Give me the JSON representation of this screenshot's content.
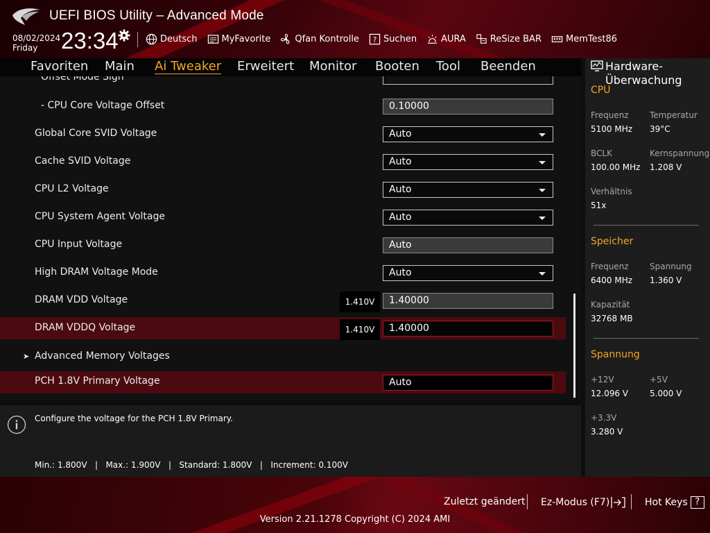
{
  "header": {
    "title": "UEFI BIOS Utility – Advanced Mode",
    "date": "08/02/2024",
    "weekday": "Friday",
    "time": "23:34",
    "toolbar": {
      "language": "Deutsch",
      "myfavorite": "MyFavorite",
      "qfan": "Qfan Kontrolle",
      "search": "Suchen",
      "aura": "AURA",
      "resizebar": "ReSize BAR",
      "memtest": "MemTest86"
    }
  },
  "nav": {
    "tabs": [
      "Favoriten",
      "Main",
      "Ai Tweaker",
      "Erweitert",
      "Monitor",
      "Booten",
      "Tool",
      "Beenden"
    ],
    "active": "Ai Tweaker"
  },
  "settings": {
    "rows": [
      {
        "label": "Offset Mode Sign",
        "value": ""
      },
      {
        "label": "- CPU Core Voltage Offset",
        "value": "0.10000"
      },
      {
        "label": "Global Core SVID Voltage",
        "value": "Auto"
      },
      {
        "label": "Cache SVID Voltage",
        "value": "Auto"
      },
      {
        "label": "CPU L2 Voltage",
        "value": "Auto"
      },
      {
        "label": "CPU System Agent Voltage",
        "value": "Auto"
      },
      {
        "label": "CPU Input Voltage",
        "value": "Auto"
      },
      {
        "label": "High DRAM Voltage Mode",
        "value": "Auto"
      },
      {
        "label": "DRAM VDD Voltage",
        "value": "1.40000",
        "current": "1.410V"
      },
      {
        "label": "DRAM VDDQ Voltage",
        "value": "1.40000",
        "current": "1.410V"
      },
      {
        "label": "Advanced Memory Voltages"
      },
      {
        "label": "PCH 1.8V Primary Voltage",
        "value": "Auto"
      }
    ]
  },
  "help": {
    "description": "Configure the voltage for the PCH 1.8V Primary.",
    "range": "Min.: 1.800V   |   Max.: 1.900V   |   Standard: 1.800V   |   Increment: 0.100V"
  },
  "hw_monitor": {
    "title": "Hardware-Überwachung",
    "cpu": {
      "heading": "CPU",
      "freq_label": "Frequenz",
      "freq": "5100 MHz",
      "temp_label": "Temperatur",
      "temp": "39°C",
      "bclk_label": "BCLK",
      "bclk": "100.00 MHz",
      "core_v_label": "Kernspannung",
      "core_v": "1.208 V",
      "ratio_label": "Verhältnis",
      "ratio": "51x"
    },
    "memory": {
      "heading": "Speicher",
      "freq_label": "Frequenz",
      "freq": "6400 MHz",
      "volt_label": "Spannung",
      "volt": "1.360 V",
      "cap_label": "Kapazität",
      "cap": "32768 MB"
    },
    "voltage": {
      "heading": "Spannung",
      "v12_label": "+12V",
      "v12": "12.096 V",
      "v5_label": "+5V",
      "v5": "5.000 V",
      "v33_label": "+3.3V",
      "v33": "3.280 V"
    }
  },
  "footer": {
    "last_changed": "Zuletzt geändert",
    "ez_mode": "Ez-Modus (F7)",
    "hotkeys": "Hot Keys",
    "hotkeys_key": "?",
    "version": "Version 2.21.1278 Copyright (C) 2024 AMI"
  },
  "colors": {
    "accent": "#f5a623",
    "highlight_row": "#4a0a10",
    "header_red": "#5a0610"
  }
}
